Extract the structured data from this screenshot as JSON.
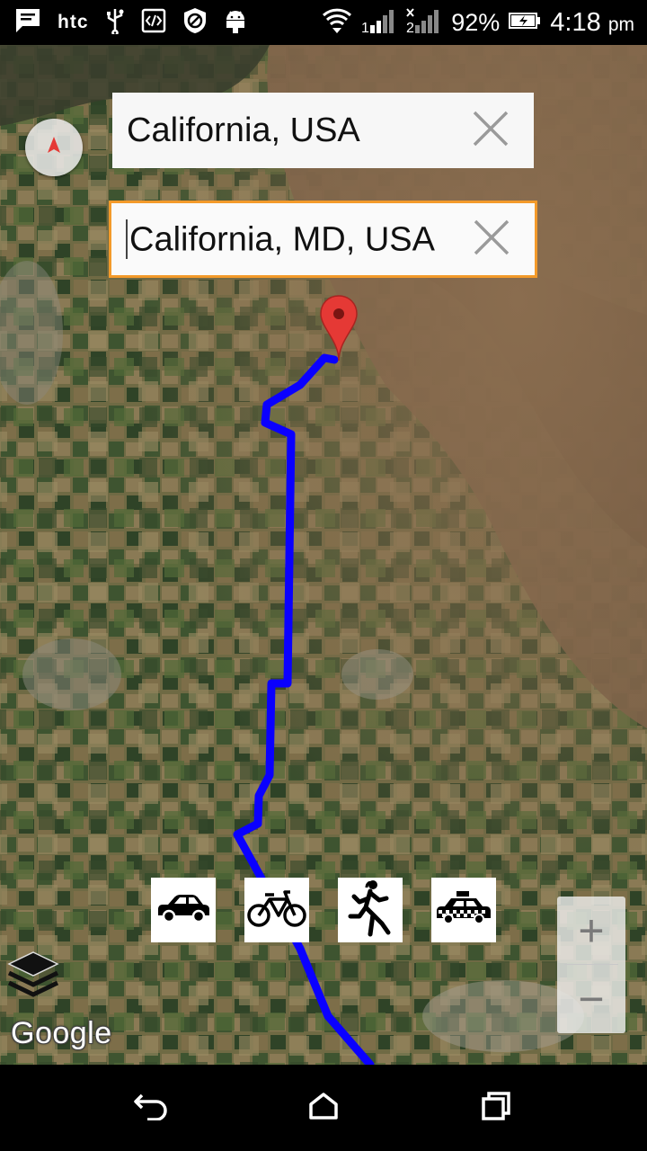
{
  "status_bar": {
    "carrier": "htc",
    "battery": "92%",
    "time": "4:18",
    "ampm": "pm",
    "icons": [
      "message-icon",
      "usb-icon",
      "developer-icon",
      "blocked-icon",
      "android-icon",
      "wifi-icon",
      "signal-icon",
      "signal-2-icon",
      "battery-icon"
    ]
  },
  "search": {
    "from_value": "California, USA",
    "to_value": "California, MD, USA"
  },
  "travel_modes": [
    "car-icon",
    "bicycle-icon",
    "walking-icon",
    "taxi-icon"
  ],
  "zoom": {
    "in": "+",
    "out": "−"
  },
  "map": {
    "attribution": "Google",
    "route_color": "#0a00ff",
    "marker_color": "#e53935"
  },
  "nav": [
    "back-icon",
    "home-icon",
    "recents-icon"
  ]
}
